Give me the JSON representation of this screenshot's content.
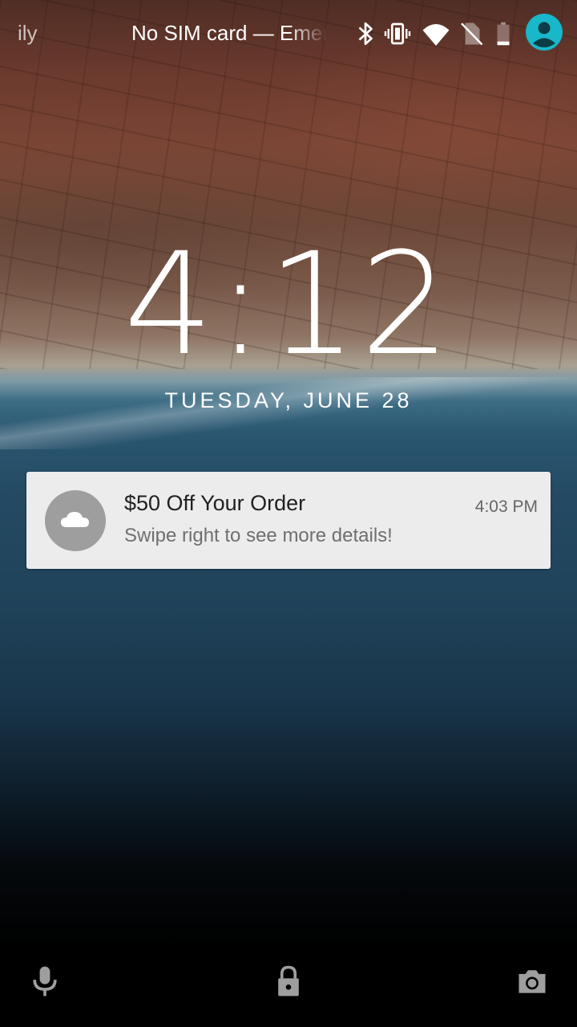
{
  "status_bar": {
    "carrier_partial": "ily",
    "carrier": "No SIM card — Emergency calls only",
    "icons": [
      "bluetooth-icon",
      "vibrate-icon",
      "wifi-icon",
      "no-sim-icon",
      "battery-icon",
      "account-icon"
    ]
  },
  "lock_screen": {
    "time": "4:12",
    "date": "TUESDAY, JUNE 28"
  },
  "notification": {
    "icon": "cloud-icon",
    "title": "$50 Off Your Order",
    "time": "4:03 PM",
    "body": "Swipe right to see more details!"
  },
  "bottom_bar": {
    "icons": [
      "microphone-icon",
      "lock-icon",
      "camera-icon"
    ]
  },
  "colors": {
    "avatar": "#18b7c9",
    "notification_bg": "#ececec",
    "notification_icon_bg": "#9e9e9e"
  }
}
